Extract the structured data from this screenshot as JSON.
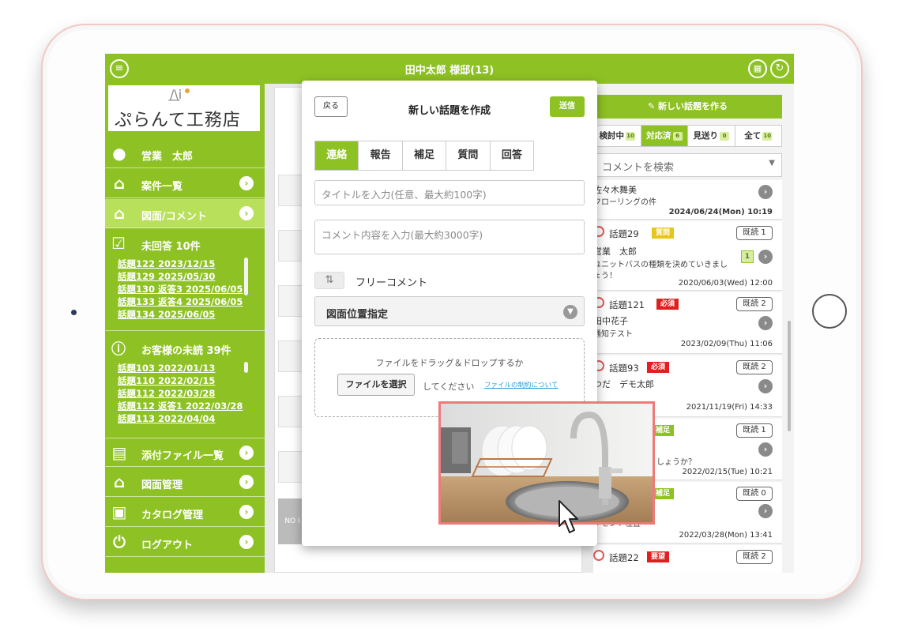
{
  "header": {
    "title": "田中太郎 様邸(13)",
    "menu_icon": "menu-icon",
    "calendar_icon": "calendar-icon",
    "refresh_icon": "refresh-icon"
  },
  "sidebar": {
    "logo_text": "ぷらんて工務店",
    "user_name": "営業　太郎",
    "items": [
      {
        "label": "案件一覧",
        "icon": "home-icon"
      },
      {
        "label": "図面/コメント",
        "icon": "house-doc-icon"
      }
    ],
    "unanswered": {
      "title": "未回答 10件",
      "links": [
        "話題122 2023/12/15",
        "話題129 2025/05/30",
        "話題130 返答3 2025/06/05",
        "話題133 返答4 2025/06/05",
        "話題134 2025/06/05"
      ]
    },
    "customer_unread": {
      "title": "お客様の未読 39件",
      "links": [
        "話題103 2022/01/13",
        "話題110 2022/02/15",
        "話題112 2022/03/28",
        "話題112 返答1 2022/03/28",
        "話題113 2022/04/04"
      ]
    },
    "bottom_items": [
      {
        "label": "添付ファイル一覧",
        "icon": "attachment-list-icon"
      },
      {
        "label": "図面管理",
        "icon": "drawing-icon"
      },
      {
        "label": "カタログ管理",
        "icon": "catalog-icon"
      },
      {
        "label": "ログアウト",
        "icon": "power-icon"
      }
    ]
  },
  "middle": {
    "no_image": "NO I"
  },
  "modal": {
    "back": "戻る",
    "title": "新しい話題を作成",
    "send": "送信",
    "types": [
      "連絡",
      "報告",
      "補足",
      "質問",
      "回答"
    ],
    "selected_type": "連絡",
    "title_placeholder": "タイトルを入力(任意、最大約100字)",
    "comment_placeholder": "コメント内容を入力(最大約3000字)",
    "free_comment": "フリーコメント",
    "position_select": "図面位置指定",
    "drop_text": "ファイルをドラッグ＆ドロップするか",
    "file_button": "ファイルを選択",
    "drop_text2": "してください",
    "file_limit_link": "ファイルの制約について"
  },
  "right_panel": {
    "new_topic": "新しい話題を作る",
    "tabs": [
      {
        "label": "検討中",
        "count": "10"
      },
      {
        "label": "対応済",
        "count": "6"
      },
      {
        "label": "見送り",
        "count": "0"
      },
      {
        "label": "全て",
        "count": "10"
      }
    ],
    "active_tab": "対応済",
    "search_placeholder": "コメントを検索",
    "topics": [
      {
        "who": "佐々木舞美",
        "msg": "フローリングの件",
        "date": "2024/06/24(Mon) 10:19"
      },
      {
        "title": "話題29",
        "badge": "質問",
        "read": "既読 1",
        "who": "営業　太郎",
        "msg": "ユニットバスの種類を決めていきまし",
        "msg2": "ょう！",
        "new_count": "1",
        "date": "2020/06/03(Wed) 12:00"
      },
      {
        "title": "話題121",
        "badge": "必須",
        "read": "既読 2",
        "who": "田中花子",
        "msg": "通知テスト",
        "date": "2023/02/09(Thu) 11:06"
      },
      {
        "title": "話題93",
        "badge": "必須",
        "read": "既読 2",
        "who": "つだ　デモ太郎",
        "msg": "",
        "date": "2021/11/19(Fri) 14:33"
      },
      {
        "title": "",
        "badge": "補足",
        "read": "既読 1",
        "who": "",
        "msg": "しょうか？",
        "date": "2022/02/15(Tue) 10:21"
      },
      {
        "title": "",
        "badge": "補足",
        "read": "既読 0",
        "who": "",
        "msg": "ンセント位置",
        "date": "2022/03/28(Mon) 13:41"
      },
      {
        "title": "話題22",
        "badge": "要望",
        "read": "既読 2"
      }
    ]
  },
  "colors": {
    "brand_green": "#8ec224",
    "badge_red": "#e02020",
    "badge_yellow": "#e8c51c",
    "photo_border": "#ef7a7a"
  }
}
